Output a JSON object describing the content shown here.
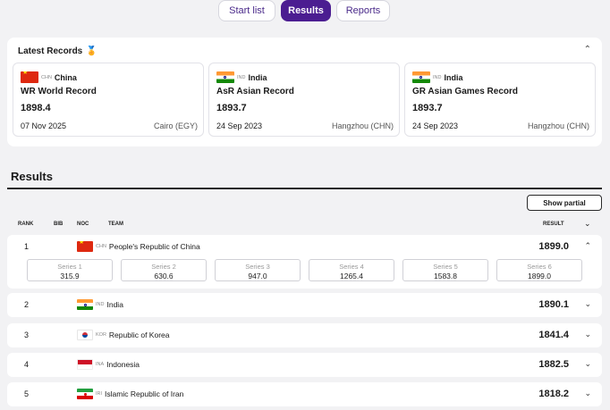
{
  "tabs": [
    {
      "label": "Start list",
      "active": false
    },
    {
      "label": "Results",
      "active": true
    },
    {
      "label": "Reports",
      "active": false
    }
  ],
  "latest_records": {
    "title": "Latest Records",
    "cards": [
      {
        "flag": "chn",
        "noc": "CHN",
        "country": "China",
        "type": "WR  World Record",
        "value": "1898.4",
        "date": "07 Nov 2025",
        "place": "Cairo (EGY)"
      },
      {
        "flag": "ind",
        "noc": "IND",
        "country": "India",
        "type": "AsR  Asian Record",
        "value": "1893.7",
        "date": "24 Sep 2023",
        "place": "Hangzhou (CHN)"
      },
      {
        "flag": "ind",
        "noc": "IND",
        "country": "India",
        "type": "GR  Asian Games Record",
        "value": "1893.7",
        "date": "24 Sep 2023",
        "place": "Hangzhou (CHN)"
      }
    ]
  },
  "results": {
    "title": "Results",
    "show_partial_label": "Show partial",
    "columns": {
      "rank": "RANK",
      "bib": "BIB",
      "noc": "NOC",
      "team": "TEAM",
      "result": "RESULT"
    },
    "rows": [
      {
        "rank": "1",
        "flag": "chn",
        "noc": "CHN",
        "team": "People's Republic of China",
        "result": "1899.0",
        "expanded": true,
        "series": [
          {
            "label": "Series 1",
            "value": "315.9"
          },
          {
            "label": "Series 2",
            "value": "630.6"
          },
          {
            "label": "Series 3",
            "value": "947.0"
          },
          {
            "label": "Series 4",
            "value": "1265.4"
          },
          {
            "label": "Series 5",
            "value": "1583.8"
          },
          {
            "label": "Series 6",
            "value": "1899.0"
          }
        ]
      },
      {
        "rank": "2",
        "flag": "ind",
        "noc": "IND",
        "team": "India",
        "result": "1890.1",
        "expanded": false
      },
      {
        "rank": "3",
        "flag": "kor",
        "noc": "KOR",
        "team": "Republic of Korea",
        "result": "1841.4",
        "expanded": false
      },
      {
        "rank": "4",
        "flag": "ina",
        "noc": "INA",
        "team": "Indonesia",
        "result": "1882.5",
        "expanded": false
      },
      {
        "rank": "5",
        "flag": "iri",
        "noc": "IRI",
        "team": "Islamic Republic of Iran",
        "result": "1818.2",
        "expanded": false
      }
    ]
  },
  "icons": {
    "collapse": "chevron-up-icon",
    "expand": "chevron-down-icon",
    "medal": "medal-icon"
  }
}
